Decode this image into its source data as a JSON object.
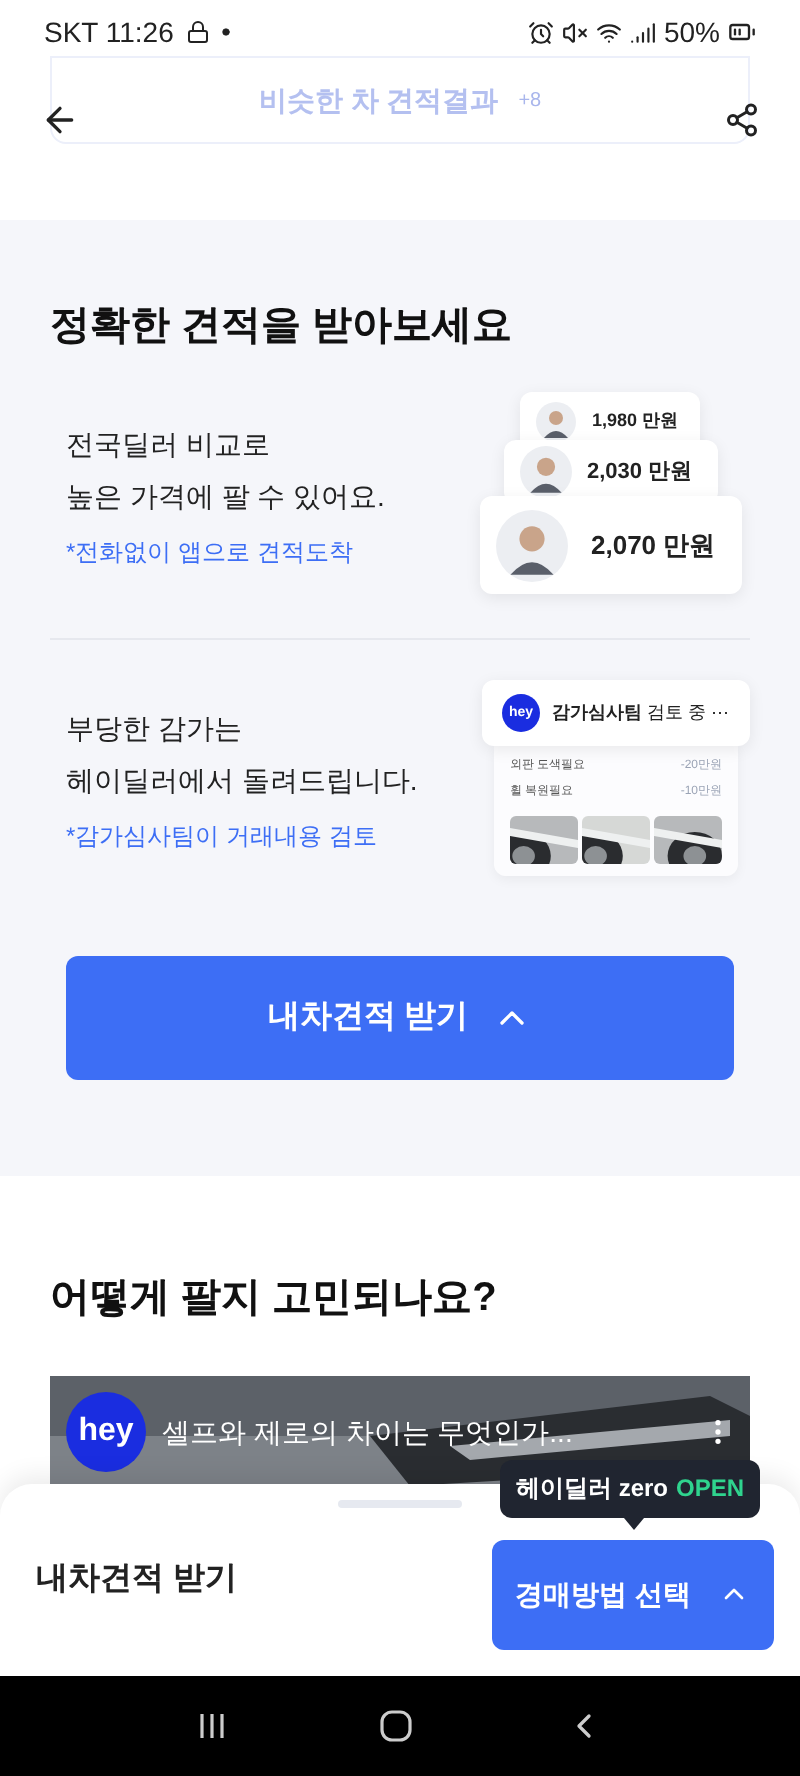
{
  "status_bar": {
    "carrier_time": "SKT 11:26",
    "battery": "50%"
  },
  "header": {
    "faded_title": "비슷한 차 견적결과",
    "faded_count": "+8"
  },
  "section1": {
    "heading": "정확한 견적을 받아보세요",
    "features": [
      {
        "kind": "quotes",
        "lines": [
          "전국딜러 비교로",
          "높은 가격에 팔 수 있어요."
        ],
        "note": "*전화없이 앱으로 견적도착",
        "quotes": [
          "1,980 만원",
          "2,030 만원",
          "2,070 만원"
        ]
      },
      {
        "kind": "review",
        "lines": [
          "부당한 감가는",
          "헤이딜러에서 돌려드립니다."
        ],
        "note": "*감가심사팀이 거래내용 검토",
        "review": {
          "logo": "hey",
          "title": "**감가심사팀** 검토 중 ⋯",
          "items": [
            {
              "label": "외판 도색필요",
              "amount": "-20만원"
            },
            {
              "label": "휠 복원필요",
              "amount": "-10만원"
            }
          ]
        }
      }
    ],
    "button": "내차견적 받기"
  },
  "section2": {
    "heading": "어떻게 팔지 고민되나요?",
    "video": {
      "channel_logo": "hey",
      "title": "셀프와 제로의 차이는 무엇인가..."
    }
  },
  "bottom_sheet": {
    "label": "내차견적 받기",
    "button": "경매방법 선택",
    "tooltip": {
      "text": "헤이딜러 zero",
      "badge": "OPEN"
    }
  }
}
